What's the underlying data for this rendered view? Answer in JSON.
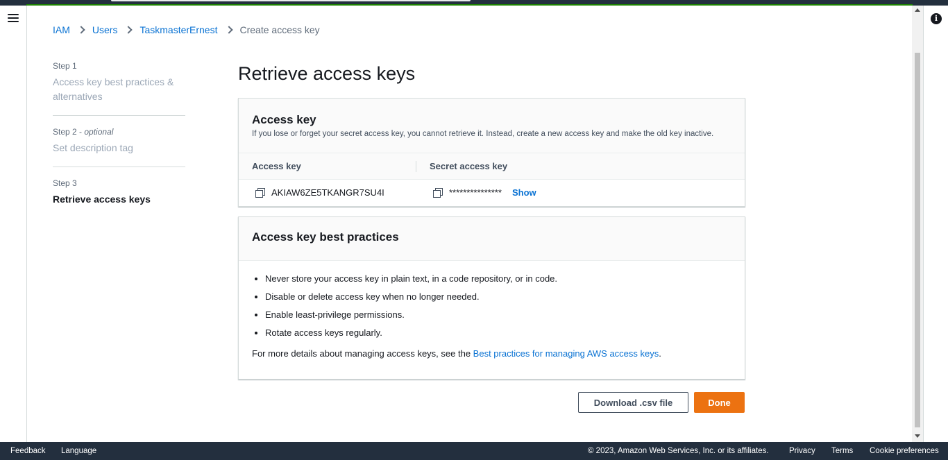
{
  "breadcrumb": {
    "items": [
      "IAM",
      "Users",
      "TaskmasterErnest"
    ],
    "current": "Create access key"
  },
  "steps": [
    {
      "number": "Step 1",
      "optional": "",
      "label": "Access key best practices & alternatives"
    },
    {
      "number": "Step 2",
      "optional": "optional",
      "label": "Set description tag"
    },
    {
      "number": "Step 3",
      "optional": "",
      "label": "Retrieve access keys"
    }
  ],
  "page_title": "Retrieve access keys",
  "access_key_panel": {
    "title": "Access key",
    "description": "If you lose or forget your secret access key, you cannot retrieve it. Instead, create a new access key and make the old key inactive.",
    "col_access_key": "Access key",
    "col_secret_key": "Secret access key",
    "access_key_value": "AKIAW6ZE5TKANGR7SU4I",
    "secret_key_masked": "***************",
    "show_label": "Show"
  },
  "best_practices_panel": {
    "title": "Access key best practices",
    "items": [
      "Never store your access key in plain text, in a code repository, or in code.",
      "Disable or delete access key when no longer needed.",
      "Enable least-privilege permissions.",
      "Rotate access keys regularly."
    ],
    "more_prefix": "For more details about managing access keys, see the ",
    "more_link": "Best practices for managing AWS access keys",
    "more_suffix": "."
  },
  "actions": {
    "download_label": "Download .csv file",
    "done_label": "Done"
  },
  "footer": {
    "feedback": "Feedback",
    "language": "Language",
    "copyright": "© 2023, Amazon Web Services, Inc. or its affiliates.",
    "privacy": "Privacy",
    "terms": "Terms",
    "cookie": "Cookie preferences"
  },
  "colors": {
    "link": "#0972d3",
    "primary_button": "#ec7211",
    "nav_dark": "#232f3e",
    "success_bar": "#1d8102"
  },
  "icons": [
    "menu-icon",
    "info-icon",
    "copy-icon",
    "chevron-right-icon"
  ]
}
